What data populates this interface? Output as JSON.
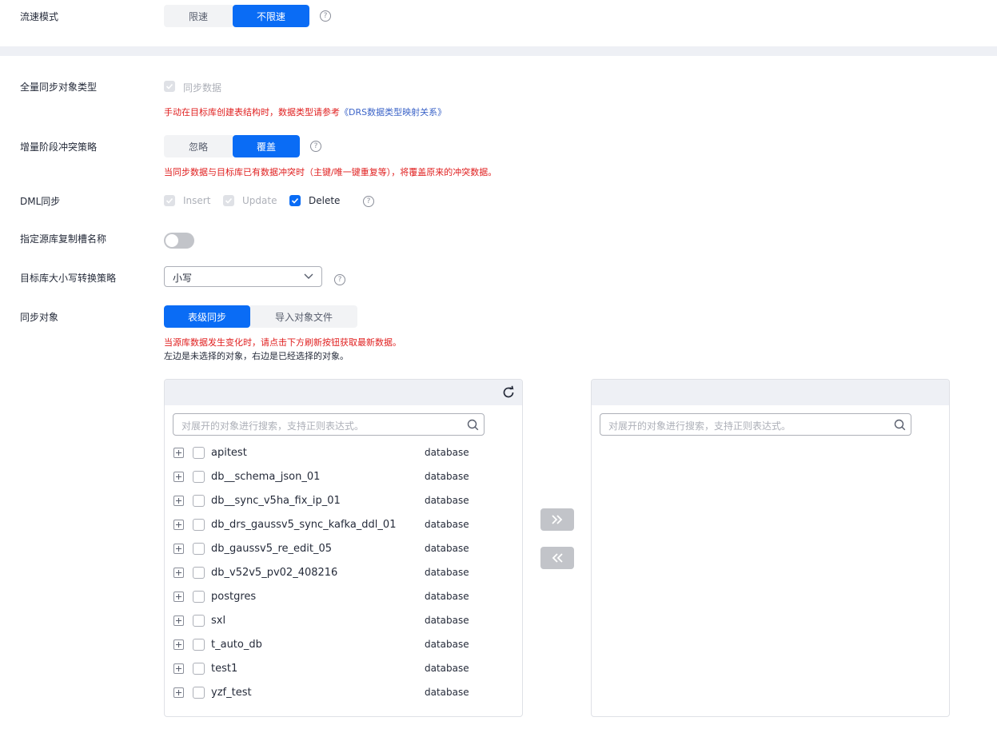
{
  "flow_mode": {
    "label": "流速模式",
    "options": [
      "限速",
      "不限速"
    ],
    "selected": "不限速"
  },
  "full_sync": {
    "label": "全量同步对象类型",
    "checkbox_label": "同步数据",
    "note_prefix": "手动在目标库创建表结构时，数据类型请参考",
    "note_link": "《DRS数据类型映射关系》"
  },
  "conflict": {
    "label": "增量阶段冲突策略",
    "options": [
      "忽略",
      "覆盖"
    ],
    "selected": "覆盖",
    "note": "当同步数据与目标库已有数据冲突时（主键/唯一键重复等），将覆盖原来的冲突数据。"
  },
  "dml": {
    "label": "DML同步",
    "insert": "Insert",
    "update": "Update",
    "delete": "Delete"
  },
  "slot_name": {
    "label": "指定源库复制槽名称",
    "enabled": false
  },
  "case_policy": {
    "label": "目标库大小写转换策略",
    "value": "小写"
  },
  "sync_objects": {
    "label": "同步对象",
    "options": [
      "表级同步",
      "导入对象文件"
    ],
    "selected": "表级同步",
    "note_red": "当源库数据发生变化时，请点击下方刷新按钮获取最新数据。",
    "note_black": "左边是未选择的对象，右边是已经选择的对象。"
  },
  "left_panel": {
    "search_placeholder": "对展开的对象进行搜索，支持正则表达式。",
    "items": [
      {
        "name": "apitest",
        "type": "database"
      },
      {
        "name": "db__schema_json_01",
        "type": "database"
      },
      {
        "name": "db__sync_v5ha_fix_ip_01",
        "type": "database"
      },
      {
        "name": "db_drs_gaussv5_sync_kafka_ddl_01",
        "type": "database"
      },
      {
        "name": "db_gaussv5_re_edit_05",
        "type": "database"
      },
      {
        "name": "db_v52v5_pv02_408216",
        "type": "database"
      },
      {
        "name": "postgres",
        "type": "database"
      },
      {
        "name": "sxl",
        "type": "database"
      },
      {
        "name": "t_auto_db",
        "type": "database"
      },
      {
        "name": "test1",
        "type": "database"
      },
      {
        "name": "yzf_test",
        "type": "database"
      }
    ]
  },
  "right_panel": {
    "search_placeholder": "对展开的对象进行搜索，支持正则表达式。"
  },
  "icons": {
    "help": "?",
    "refresh": "refresh-icon",
    "search": "search-icon",
    "move_right": "double-chevron-right-icon",
    "move_left": "double-chevron-left-icon"
  },
  "colors": {
    "primary": "#0a6cf5",
    "danger": "#e02020",
    "link": "#3c64c8"
  }
}
